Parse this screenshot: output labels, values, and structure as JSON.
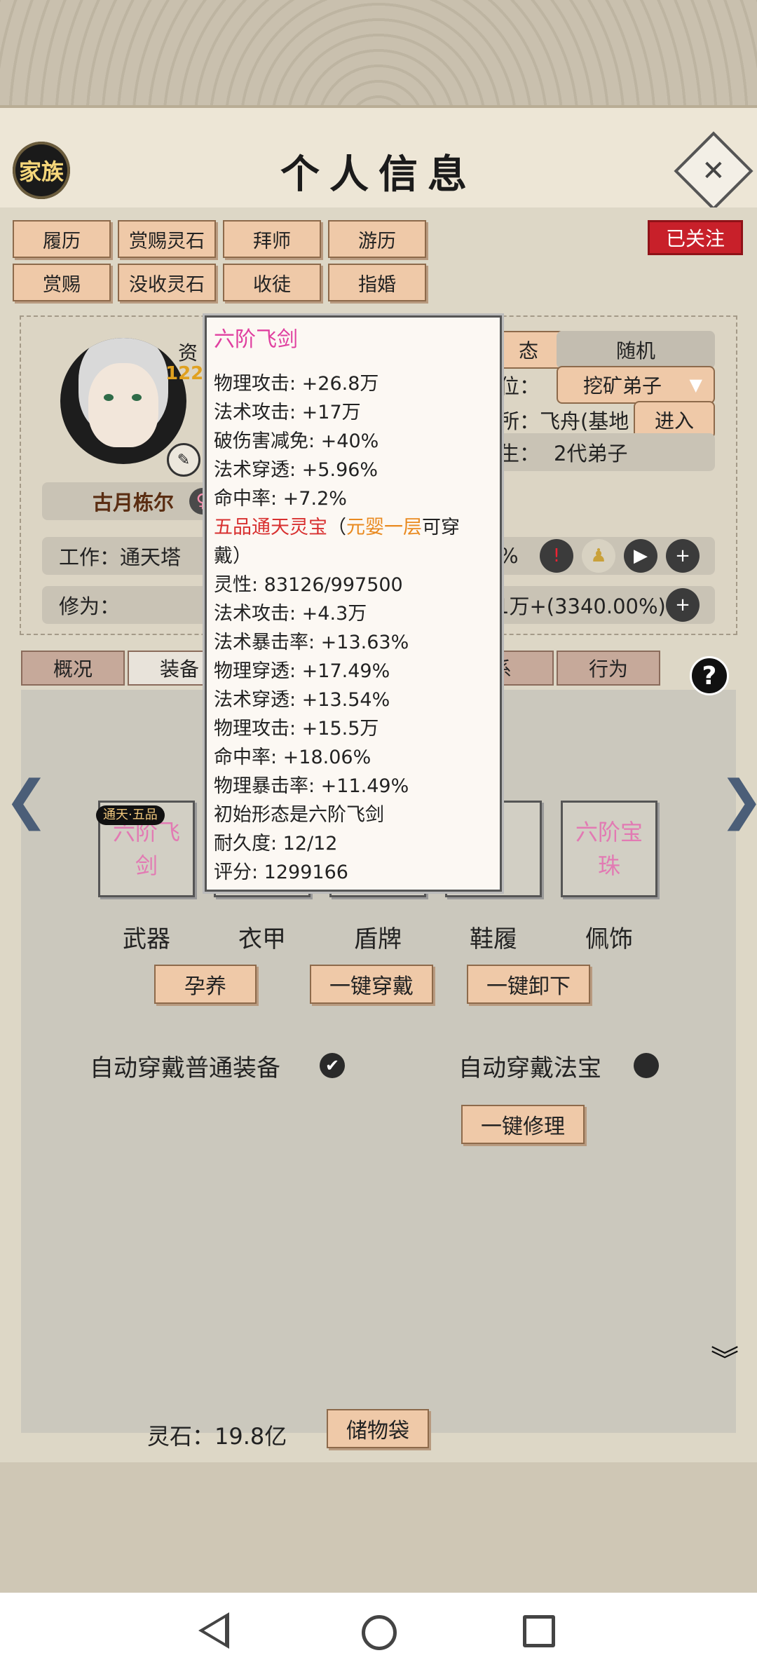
{
  "header": {
    "family_label": "家族",
    "title": "个人信息"
  },
  "top_buttons": [
    "履历",
    "赏赐灵石",
    "拜师",
    "游历",
    "赏赐",
    "没收灵石",
    "收徒",
    "指婚"
  ],
  "followed_badge": "已关注",
  "profile": {
    "zi_label": "资",
    "zi_value": "122",
    "name": "古月栋尔",
    "status_partial": "态",
    "random_button": "随机",
    "position_label": "位：",
    "position_value": "挖矿弟子",
    "location_label": "所：飞舟(基地",
    "enter_button": "进入",
    "generation_label": "生：",
    "generation_value": "2代弟子",
    "job_label": "工作：通天塔",
    "job_percent": "%",
    "cultivation_label": "修为：",
    "cultivation_value": "1万+(3340.00%)"
  },
  "tabs": [
    "概况",
    "装备",
    "系",
    "行为"
  ],
  "tooltip": {
    "title": "六阶飞剑",
    "lines_a": [
      "物理攻击: +26.8万",
      "法术攻击: +17万",
      "破伤害减免: +40%",
      "法术穿透: +5.96%",
      "命中率: +7.2%"
    ],
    "treasure_name": "五品通天灵宝",
    "paren_open": "（",
    "treasure_req": "元婴一层",
    "treasure_tail": "可穿",
    "treasure_tail2": "戴）",
    "lines_b": [
      "灵性: 83126/997500",
      "法术攻击: +4.3万",
      "法术暴击率: +13.63%",
      "物理穿透: +17.49%",
      "法术穿透: +13.54%",
      "物理攻击: +15.5万",
      "命中率: +18.06%",
      "物理暴击率: +11.49%",
      "初始形态是六阶飞剑",
      "耐久度: 12/12",
      "评分: 1299166"
    ]
  },
  "equipment": {
    "slots": [
      {
        "item": "六阶飞剑",
        "badge": "通天·五品",
        "label": "武器"
      },
      {
        "item": "",
        "label": "衣甲"
      },
      {
        "item": "",
        "label": "盾牌"
      },
      {
        "item": "飞",
        "label": "鞋履"
      },
      {
        "item": "六阶宝珠",
        "label": "佩饰"
      }
    ],
    "nurture_button": "孕养",
    "equip_all_button": "一键穿戴",
    "unequip_all_button": "一键卸下",
    "auto_equip_normal_label": "自动穿戴普通装备",
    "auto_equip_normal_checked": true,
    "auto_equip_treasure_label": "自动穿戴法宝",
    "auto_equip_treasure_checked": false,
    "repair_all_button": "一键修理"
  },
  "footer": {
    "spirit_stone_label": "灵石：19.8亿",
    "storage_bag_button": "储物袋"
  },
  "colors": {
    "accent_button": "#efc9a8",
    "followed_red": "#c8202a",
    "item_pink": "#e27ab3",
    "tooltip_title": "#e040a0"
  }
}
